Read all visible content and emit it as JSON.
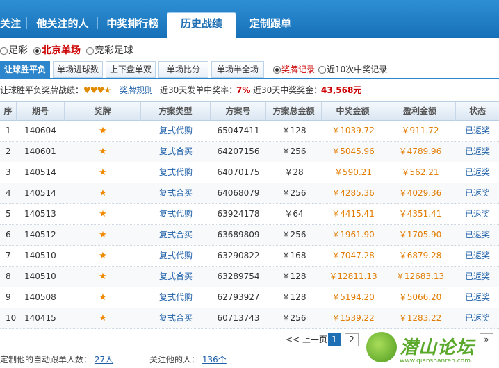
{
  "top_tabs": [
    "关注",
    "他关注的人",
    "中奖排行榜",
    "历史战绩",
    "定制跟单"
  ],
  "top_tab_active": 3,
  "lotteries": [
    {
      "label": "足彩",
      "selected": false
    },
    {
      "label": "北京单场",
      "selected": true
    },
    {
      "label": "竞彩足球",
      "selected": false
    }
  ],
  "sub_tabs": [
    "让球胜平负",
    "单场进球数",
    "上下盘单双",
    "单场比分",
    "单场半全场"
  ],
  "sub_tab_active": 0,
  "record_options": [
    {
      "label": "奖牌记录",
      "selected": true
    },
    {
      "label": "近10次中奖记录",
      "selected": false
    }
  ],
  "summary": {
    "prefix": "让球胜平负奖牌战绩：",
    "medals": "♥♥♥★",
    "rules_link": "奖牌规则",
    "rate_label": "近30天发单中奖率：",
    "rate_value": "7%",
    "bonus_label": "近30天中奖奖金：",
    "bonus_value": "43,568元"
  },
  "table": {
    "headers": [
      "序",
      "期号",
      "奖牌",
      "方案类型",
      "方案号",
      "方案总金额",
      "中奖金额",
      "盈利金额",
      "状态"
    ],
    "rows": [
      [
        "1",
        "140604",
        "★",
        "复式代购",
        "65047411",
        "￥128",
        "￥1039.72",
        "￥911.72",
        "已返奖"
      ],
      [
        "2",
        "140601",
        "★",
        "复式合买",
        "64207156",
        "￥256",
        "￥5045.96",
        "￥4789.96",
        "已返奖"
      ],
      [
        "3",
        "140514",
        "★",
        "复式代购",
        "64070175",
        "￥28",
        "￥590.21",
        "￥562.21",
        "已返奖"
      ],
      [
        "4",
        "140514",
        "★",
        "复式合买",
        "64068079",
        "￥256",
        "￥4285.36",
        "￥4029.36",
        "已返奖"
      ],
      [
        "5",
        "140513",
        "★",
        "复式代购",
        "63924178",
        "￥64",
        "￥4415.41",
        "￥4351.41",
        "已返奖"
      ],
      [
        "6",
        "140512",
        "★",
        "复式合买",
        "63689809",
        "￥256",
        "￥1961.90",
        "￥1705.90",
        "已返奖"
      ],
      [
        "7",
        "140510",
        "★",
        "复式代购",
        "63290822",
        "￥168",
        "￥7047.28",
        "￥6879.28",
        "已返奖"
      ],
      [
        "8",
        "140510",
        "★",
        "复式合买",
        "63289754",
        "￥128",
        "￥12811.13",
        "￥12683.13",
        "已返奖"
      ],
      [
        "9",
        "140508",
        "★",
        "复式代购",
        "62793927",
        "￥128",
        "￥5194.20",
        "￥5066.20",
        "已返奖"
      ],
      [
        "10",
        "140415",
        "★",
        "复式合买",
        "60713743",
        "￥256",
        "￥1539.22",
        "￥1283.22",
        "已返奖"
      ]
    ]
  },
  "pager": {
    "prev": "<< 上一页",
    "pages": [
      "1",
      "2"
    ],
    "current": "1",
    "last": "»"
  },
  "footer": {
    "auto_label": "定制他的自动跟单人数：",
    "auto_value": "27人",
    "follow_label": "关注他的人：",
    "follow_value": "136个"
  },
  "watermark": {
    "title": "潜山论坛",
    "url": "www.qianshanren.com"
  }
}
